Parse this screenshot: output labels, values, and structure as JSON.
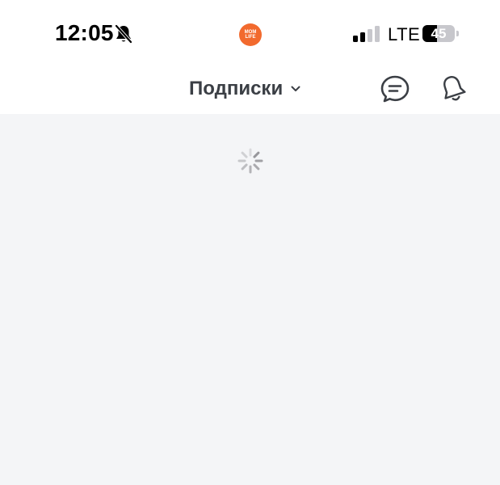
{
  "status_bar": {
    "time": "12:05",
    "network": "LTE",
    "battery_level": "45",
    "battery_fraction": 0.45,
    "icons": [
      "bell-slash-icon",
      "app-logo",
      "signal-icon",
      "battery-icon"
    ]
  },
  "app": {
    "logo_line1": "MOM",
    "logo_line2": "LIFE",
    "logo_color": "#f26a2e"
  },
  "header": {
    "feed_label": "Подписки",
    "icons": [
      "chevron-down-icon",
      "chat-icon",
      "bell-icon"
    ]
  },
  "content": {
    "state": "loading",
    "background": "#f4f5f7"
  }
}
